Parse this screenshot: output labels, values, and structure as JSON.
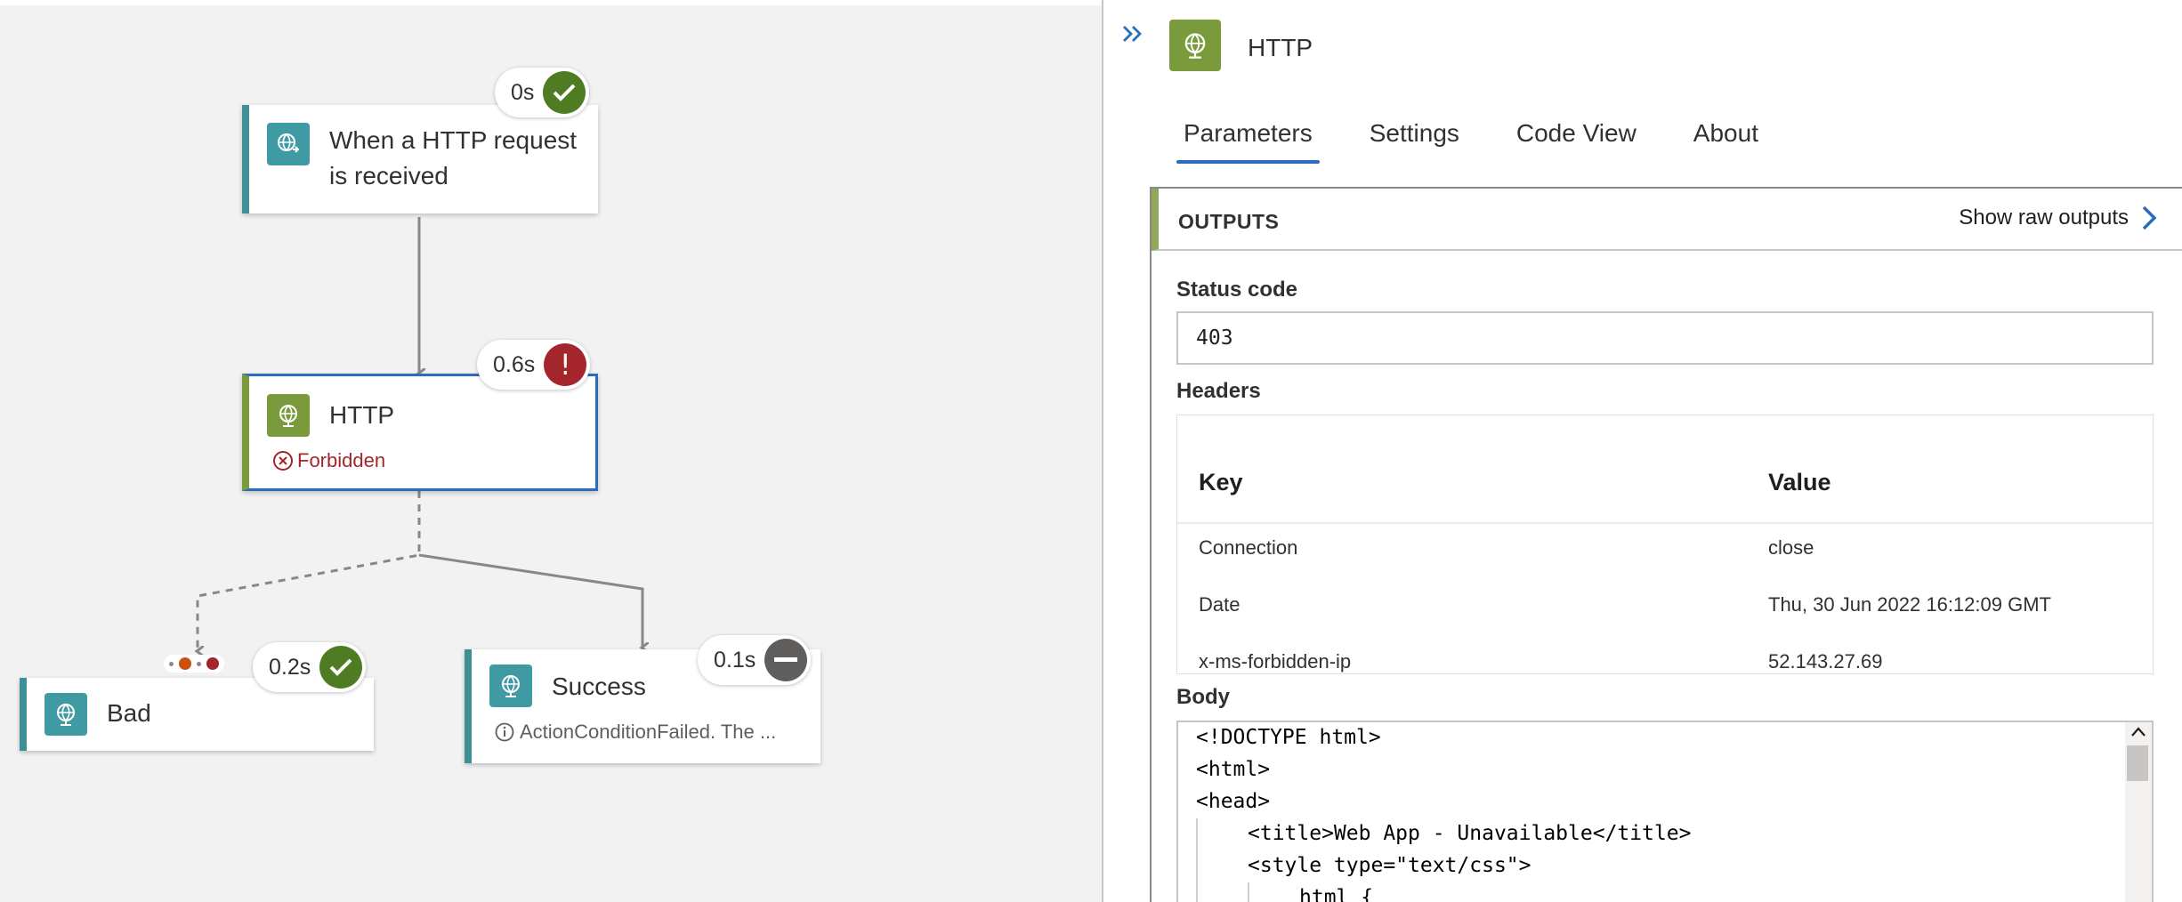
{
  "workflow": {
    "trigger": {
      "title_line1": "When a HTTP request",
      "title_line2": "is received",
      "duration": "0s",
      "status": "succeeded"
    },
    "http": {
      "title": "HTTP",
      "status_text": "Forbidden",
      "duration": "0.6s",
      "status": "failed"
    },
    "bad": {
      "title": "Bad",
      "duration": "0.2s",
      "status": "succeeded"
    },
    "success": {
      "title": "Success",
      "message": "ActionConditionFailed. The ...",
      "duration": "0.1s",
      "status": "skipped"
    }
  },
  "panel": {
    "title": "HTTP",
    "tabs": [
      {
        "label": "Parameters",
        "active": true
      },
      {
        "label": "Settings",
        "active": false
      },
      {
        "label": "Code View",
        "active": false
      },
      {
        "label": "About",
        "active": false
      }
    ],
    "outputs": {
      "section_label": "OUTPUTS",
      "raw_link": "Show raw outputs",
      "status_code_label": "Status code",
      "status_code": "403",
      "headers_label": "Headers",
      "headers_columns": {
        "key": "Key",
        "value": "Value"
      },
      "headers_rows": [
        {
          "key": "Connection",
          "value": "close"
        },
        {
          "key": "Date",
          "value": "Thu, 30 Jun 2022 16:12:09 GMT"
        },
        {
          "key": "x-ms-forbidden-ip",
          "value": "52.143.27.69"
        }
      ],
      "body_label": "Body",
      "body_lines": [
        "<!DOCTYPE html>",
        "<html>",
        "<head>",
        "<title>Web App - Unavailable</title>",
        "<style type=\"text/css\">",
        "html {"
      ]
    }
  },
  "colors": {
    "accent_blue": "#2b6cc0",
    "success_green": "#4f7c22",
    "error_red": "#a4262c",
    "skipped_gray": "#605e5c",
    "connector_teal": "#3f9aa3",
    "http_green": "#7a9b3c"
  }
}
